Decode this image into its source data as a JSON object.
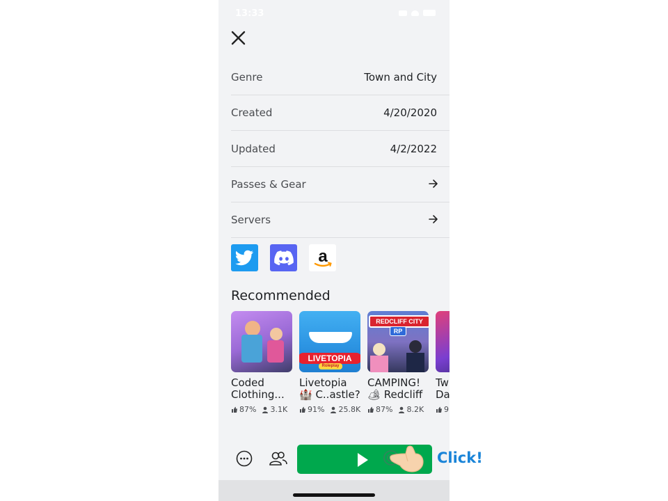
{
  "status_bar": {
    "time": "13:33"
  },
  "details": [
    {
      "label": "Genre",
      "value": "Town and City"
    },
    {
      "label": "Created",
      "value": "4/20/2020"
    },
    {
      "label": "Updated",
      "value": "4/2/2022"
    },
    {
      "label": "Passes & Gear",
      "icon": "arrow-right-icon"
    },
    {
      "label": "Servers",
      "icon": "arrow-right-icon"
    }
  ],
  "social_links": [
    "twitter-icon",
    "discord-icon",
    "amazon-icon"
  ],
  "recommended": {
    "title": "Recommended",
    "games": [
      {
        "name_line1": "Coded",
        "name_line2": "Clothing...",
        "likes": "87%",
        "players": "3.1K"
      },
      {
        "name_line1": "Livetopia",
        "name_line2": "🏰 C..astle?",
        "likes": "91%",
        "players": "25.8K",
        "thumb_text": "LIVETOPIA",
        "thumb_subtext": "Roleplay"
      },
      {
        "name_line1": "CAMPING!",
        "name_line2": "🏕 Redcliff",
        "likes": "87%",
        "players": "8.2K",
        "thumb_text": "REDCLIFF CITY",
        "thumb_subtext": "RP"
      },
      {
        "name_line1": "Tw",
        "name_line2": "Da",
        "likes": "9"
      }
    ]
  },
  "bottom_bar": {
    "play_button": "play-icon"
  },
  "annotation": {
    "click_text": "Click!"
  },
  "colors": {
    "play_green": "#00a84d",
    "twitter": "#1d9bf0",
    "discord": "#5865f2",
    "click_blue": "#1a84d8"
  }
}
